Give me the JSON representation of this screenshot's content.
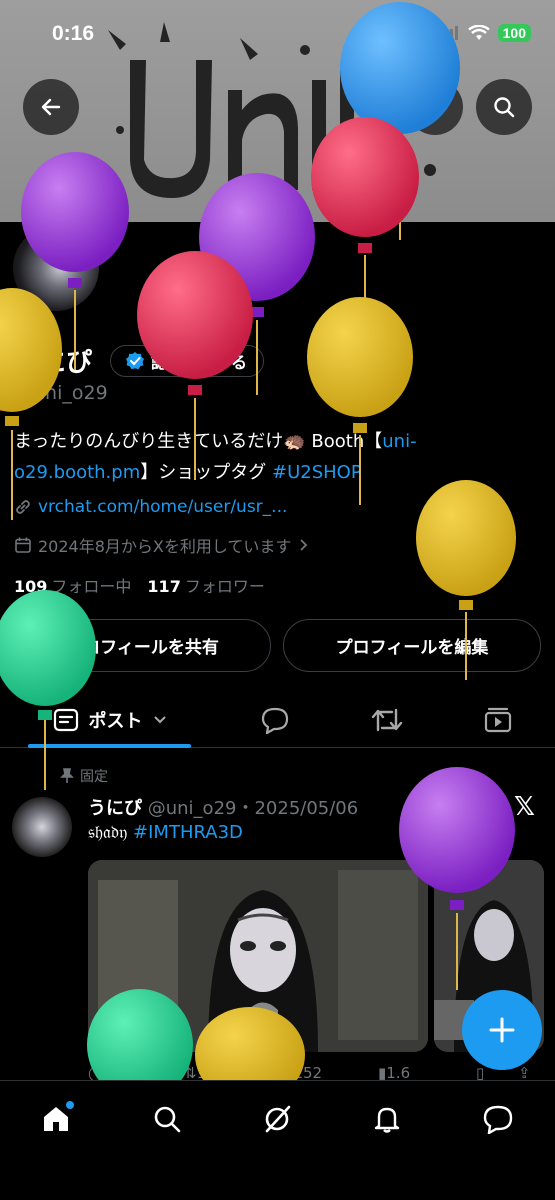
{
  "status_bar": {
    "time": "0:16",
    "battery": "100"
  },
  "header": {
    "back_icon": "arrow-left-icon",
    "menu_icon": "more-icon",
    "search_icon": "search-icon"
  },
  "profile": {
    "display_name": "うにぴ",
    "verify_label": "認証を受ける",
    "handle": "@uni_o29",
    "bio_text": "まったりのんびり生きているだけ🦔 Booth【",
    "bio_link": "uni-o29.booth.pm",
    "bio_text2": "】ショップタグ ",
    "bio_tag": "#U2SHOP",
    "website": "vrchat.com/home/user/usr_...",
    "joined": "2024年8月からXを利用しています",
    "following_count": "109",
    "following_label": "フォロー中",
    "followers_count": "117",
    "followers_label": "フォロワー"
  },
  "buttons": {
    "share": "プロフィールを共有",
    "edit": "プロフィールを編集"
  },
  "tabs": {
    "posts": "ポスト"
  },
  "post": {
    "pinned_label": "固定",
    "author": "うにぴ",
    "handle_date": "@uni_o29・2025/05/06",
    "text_prefix": "𝔰𝔥𝔞𝔡𝔶",
    "tag": "#IMTHRA3D",
    "replies": "3",
    "reposts": "18",
    "likes": "152",
    "views": "1.6万"
  },
  "colors": {
    "accent": "#1d9bf0",
    "background": "#000000",
    "muted": "#71767b"
  }
}
